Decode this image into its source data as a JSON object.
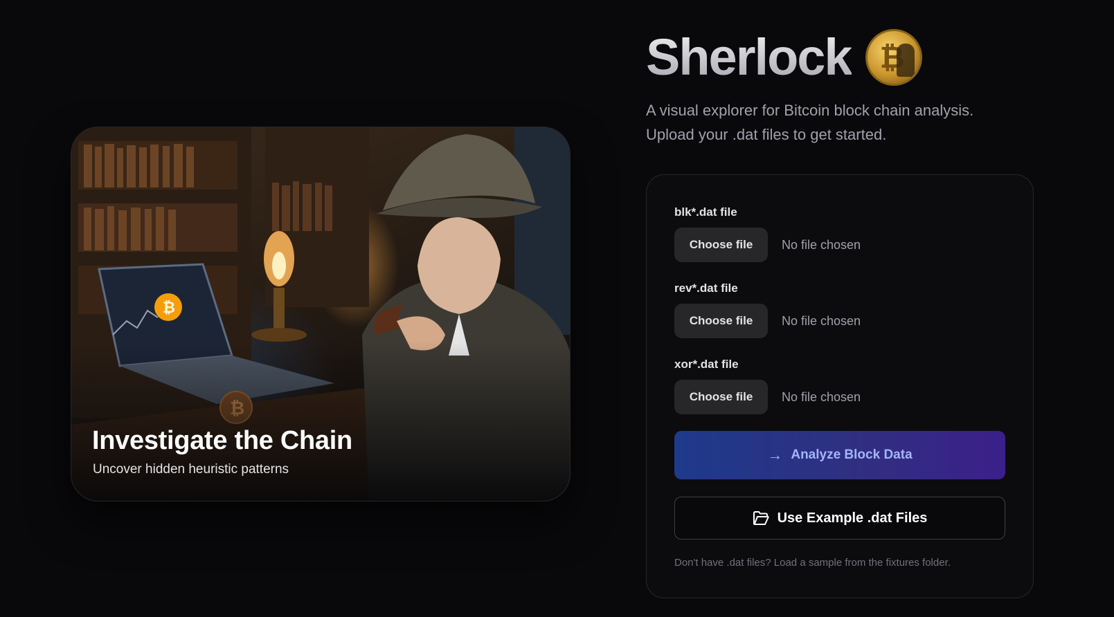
{
  "hero": {
    "title": "Investigate the Chain",
    "subtitle": "Uncover hidden heuristic patterns",
    "image_icon": "detective-with-laptop-illustration"
  },
  "brand": {
    "title": "Sherlock",
    "coin_icon": "bitcoin-detective-coin",
    "coin_glyph": "₿",
    "tagline_line1": "A visual explorer for Bitcoin block chain analysis.",
    "tagline_line2": "Upload your .dat files to get started."
  },
  "upload": {
    "fields": [
      {
        "label": "blk*.dat file",
        "button": "Choose file",
        "status": "No file chosen"
      },
      {
        "label": "rev*.dat file",
        "button": "Choose file",
        "status": "No file chosen"
      },
      {
        "label": "xor*.dat file",
        "button": "Choose file",
        "status": "No file chosen"
      }
    ],
    "analyze_label": "Analyze Block Data",
    "analyze_icon": "arrow-right-icon",
    "example_label": "Use Example .dat Files",
    "example_icon": "folder-open-icon",
    "hint": "Don't have .dat files? Load a sample from the fixtures folder."
  },
  "colors": {
    "background": "#09090b",
    "panel_border": "#27272a",
    "accent_start": "#1e3a8a",
    "accent_end": "#3b1f8a"
  }
}
